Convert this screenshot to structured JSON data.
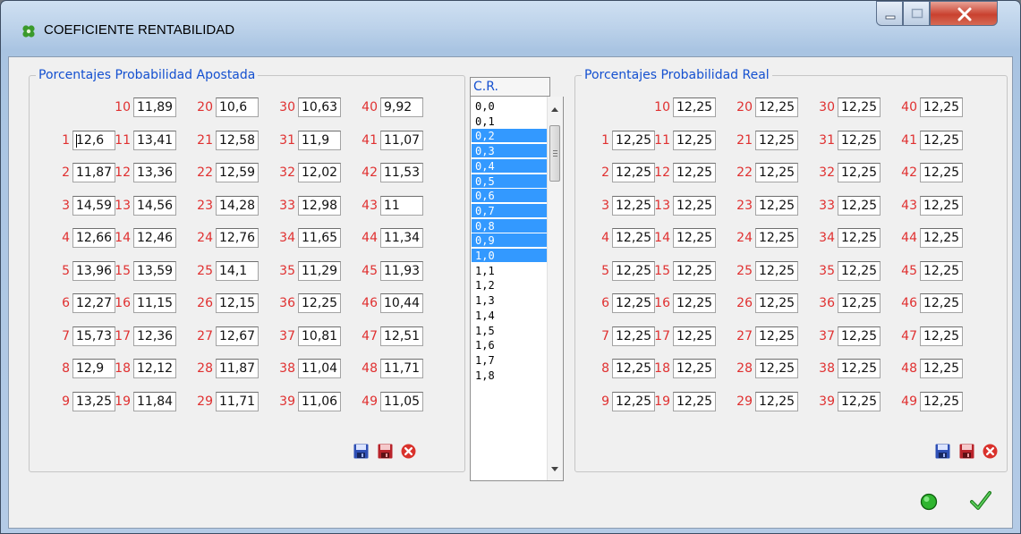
{
  "window": {
    "title": "COEFICIENTE RENTABILIDAD"
  },
  "left_group": {
    "title": "Porcentajes Probabilidad Apostada",
    "rows": [
      {
        "c2": {
          "label": "10",
          "value": "11,89"
        },
        "c3": {
          "label": "20",
          "value": "10,6"
        },
        "c4": {
          "label": "30",
          "value": "10,63"
        },
        "c5": {
          "label": "40",
          "value": "9,92"
        }
      },
      {
        "c1": {
          "label": "1",
          "value": "12,6"
        },
        "c2": {
          "label": "11",
          "value": "13,41"
        },
        "c3": {
          "label": "21",
          "value": "12,58"
        },
        "c4": {
          "label": "31",
          "value": "11,9"
        },
        "c5": {
          "label": "41",
          "value": "11,07"
        }
      },
      {
        "c1": {
          "label": "2",
          "value": "11,87"
        },
        "c2": {
          "label": "12",
          "value": "13,36"
        },
        "c3": {
          "label": "22",
          "value": "12,59"
        },
        "c4": {
          "label": "32",
          "value": "12,02"
        },
        "c5": {
          "label": "42",
          "value": "11,53"
        }
      },
      {
        "c1": {
          "label": "3",
          "value": "14,59"
        },
        "c2": {
          "label": "13",
          "value": "14,56"
        },
        "c3": {
          "label": "23",
          "value": "14,28"
        },
        "c4": {
          "label": "33",
          "value": "12,98"
        },
        "c5": {
          "label": "43",
          "value": "11"
        }
      },
      {
        "c1": {
          "label": "4",
          "value": "12,66"
        },
        "c2": {
          "label": "14",
          "value": "12,46"
        },
        "c3": {
          "label": "24",
          "value": "12,76"
        },
        "c4": {
          "label": "34",
          "value": "11,65"
        },
        "c5": {
          "label": "44",
          "value": "11,34"
        }
      },
      {
        "c1": {
          "label": "5",
          "value": "13,96"
        },
        "c2": {
          "label": "15",
          "value": "13,59"
        },
        "c3": {
          "label": "25",
          "value": "14,1"
        },
        "c4": {
          "label": "35",
          "value": "11,29"
        },
        "c5": {
          "label": "45",
          "value": "11,93"
        }
      },
      {
        "c1": {
          "label": "6",
          "value": "12,27"
        },
        "c2": {
          "label": "16",
          "value": "11,15"
        },
        "c3": {
          "label": "26",
          "value": "12,15"
        },
        "c4": {
          "label": "36",
          "value": "12,25"
        },
        "c5": {
          "label": "46",
          "value": "10,44"
        }
      },
      {
        "c1": {
          "label": "7",
          "value": "15,73"
        },
        "c2": {
          "label": "17",
          "value": "12,36"
        },
        "c3": {
          "label": "27",
          "value": "12,67"
        },
        "c4": {
          "label": "37",
          "value": "10,81"
        },
        "c5": {
          "label": "47",
          "value": "12,51"
        }
      },
      {
        "c1": {
          "label": "8",
          "value": "12,9"
        },
        "c2": {
          "label": "18",
          "value": "12,12"
        },
        "c3": {
          "label": "28",
          "value": "11,87"
        },
        "c4": {
          "label": "38",
          "value": "11,04"
        },
        "c5": {
          "label": "48",
          "value": "11,71"
        }
      },
      {
        "c1": {
          "label": "9",
          "value": "13,25"
        },
        "c2": {
          "label": "19",
          "value": "11,84"
        },
        "c3": {
          "label": "29",
          "value": "11,71"
        },
        "c4": {
          "label": "39",
          "value": "11,06"
        },
        "c5": {
          "label": "49",
          "value": "11,05"
        }
      }
    ]
  },
  "right_group": {
    "title": "Porcentajes Probabilidad Real",
    "rows": [
      {
        "c2": {
          "label": "10",
          "value": "12,25"
        },
        "c3": {
          "label": "20",
          "value": "12,25"
        },
        "c4": {
          "label": "30",
          "value": "12,25"
        },
        "c5": {
          "label": "40",
          "value": "12,25"
        }
      },
      {
        "c1": {
          "label": "1",
          "value": "12,25"
        },
        "c2": {
          "label": "11",
          "value": "12,25"
        },
        "c3": {
          "label": "21",
          "value": "12,25"
        },
        "c4": {
          "label": "31",
          "value": "12,25"
        },
        "c5": {
          "label": "41",
          "value": "12,25"
        }
      },
      {
        "c1": {
          "label": "2",
          "value": "12,25"
        },
        "c2": {
          "label": "12",
          "value": "12,25"
        },
        "c3": {
          "label": "22",
          "value": "12,25"
        },
        "c4": {
          "label": "32",
          "value": "12,25"
        },
        "c5": {
          "label": "42",
          "value": "12,25"
        }
      },
      {
        "c1": {
          "label": "3",
          "value": "12,25"
        },
        "c2": {
          "label": "13",
          "value": "12,25"
        },
        "c3": {
          "label": "23",
          "value": "12,25"
        },
        "c4": {
          "label": "33",
          "value": "12,25"
        },
        "c5": {
          "label": "43",
          "value": "12,25"
        }
      },
      {
        "c1": {
          "label": "4",
          "value": "12,25"
        },
        "c2": {
          "label": "14",
          "value": "12,25"
        },
        "c3": {
          "label": "24",
          "value": "12,25"
        },
        "c4": {
          "label": "34",
          "value": "12,25"
        },
        "c5": {
          "label": "44",
          "value": "12,25"
        }
      },
      {
        "c1": {
          "label": "5",
          "value": "12,25"
        },
        "c2": {
          "label": "15",
          "value": "12,25"
        },
        "c3": {
          "label": "25",
          "value": "12,25"
        },
        "c4": {
          "label": "35",
          "value": "12,25"
        },
        "c5": {
          "label": "45",
          "value": "12,25"
        }
      },
      {
        "c1": {
          "label": "6",
          "value": "12,25"
        },
        "c2": {
          "label": "16",
          "value": "12,25"
        },
        "c3": {
          "label": "26",
          "value": "12,25"
        },
        "c4": {
          "label": "36",
          "value": "12,25"
        },
        "c5": {
          "label": "46",
          "value": "12,25"
        }
      },
      {
        "c1": {
          "label": "7",
          "value": "12,25"
        },
        "c2": {
          "label": "17",
          "value": "12,25"
        },
        "c3": {
          "label": "27",
          "value": "12,25"
        },
        "c4": {
          "label": "37",
          "value": "12,25"
        },
        "c5": {
          "label": "47",
          "value": "12,25"
        }
      },
      {
        "c1": {
          "label": "8",
          "value": "12,25"
        },
        "c2": {
          "label": "18",
          "value": "12,25"
        },
        "c3": {
          "label": "28",
          "value": "12,25"
        },
        "c4": {
          "label": "38",
          "value": "12,25"
        },
        "c5": {
          "label": "48",
          "value": "12,25"
        }
      },
      {
        "c1": {
          "label": "9",
          "value": "12,25"
        },
        "c2": {
          "label": "19",
          "value": "12,25"
        },
        "c3": {
          "label": "29",
          "value": "12,25"
        },
        "c4": {
          "label": "39",
          "value": "12,25"
        },
        "c5": {
          "label": "49",
          "value": "12,25"
        }
      }
    ]
  },
  "cr_list": {
    "header": "C.R.",
    "items": [
      "0,0",
      "0,1",
      "0,2",
      "0,3",
      "0,4",
      "0,5",
      "0,6",
      "0,7",
      "0,8",
      "0,9",
      "1,0",
      "1,1",
      "1,2",
      "1,3",
      "1,4",
      "1,5",
      "1,6",
      "1,7",
      "1,8"
    ],
    "selected": [
      "0,2",
      "0,3",
      "0,4",
      "0,5",
      "0,6",
      "0,7",
      "0,8",
      "0,9",
      "1,0"
    ]
  },
  "icons": {
    "title": "clover-icon",
    "save": "blue-floppy-icon",
    "load": "red-floppy-icon",
    "clear": "red-x-circle-icon",
    "calculate": "green-circle-icon",
    "accept": "green-check-icon"
  },
  "colors": {
    "label": "#e03030",
    "group_title": "#1450d0",
    "selection": "#3399ff",
    "field_text": "#111111"
  }
}
